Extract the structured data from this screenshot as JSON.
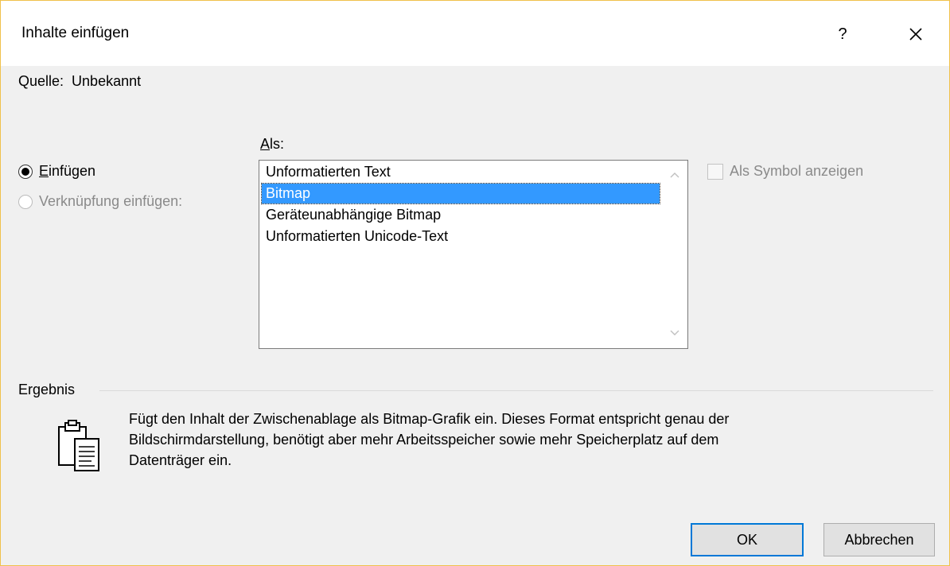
{
  "dialog": {
    "title": "Inhalte einfügen",
    "help": "?"
  },
  "quelle": {
    "label": "Quelle:",
    "value": "Unbekannt"
  },
  "radios": {
    "einfuegen": {
      "accel": "E",
      "rest": "infügen",
      "checked": true
    },
    "verknuepfung": {
      "label": "Verknüpfung einfügen:",
      "enabled": false
    }
  },
  "als": {
    "accel": "A",
    "rest": "ls:"
  },
  "formats": {
    "items": [
      "Unformatierten Text",
      "Bitmap",
      "Geräteunabhängige Bitmap",
      "Unformatierten Unicode-Text"
    ],
    "selected_index": 1
  },
  "symbol_checkbox": {
    "label": "Als Symbol anzeigen",
    "checked": false,
    "enabled": false
  },
  "ergebnis": {
    "label": "Ergebnis",
    "lines": [
      "Fügt den Inhalt der Zwischenablage als Bitmap-Grafik ein. Dieses Format entspricht genau der",
      "Bildschirmdarstellung, benötigt aber mehr Arbeitsspeicher sowie mehr Speicherplatz auf dem",
      "Datenträger ein."
    ]
  },
  "buttons": {
    "ok": "OK",
    "cancel": "Abbrechen"
  },
  "colors": {
    "selection": "#3399ff",
    "default_button_border": "#0078d7",
    "window_border": "#f0c14b"
  }
}
